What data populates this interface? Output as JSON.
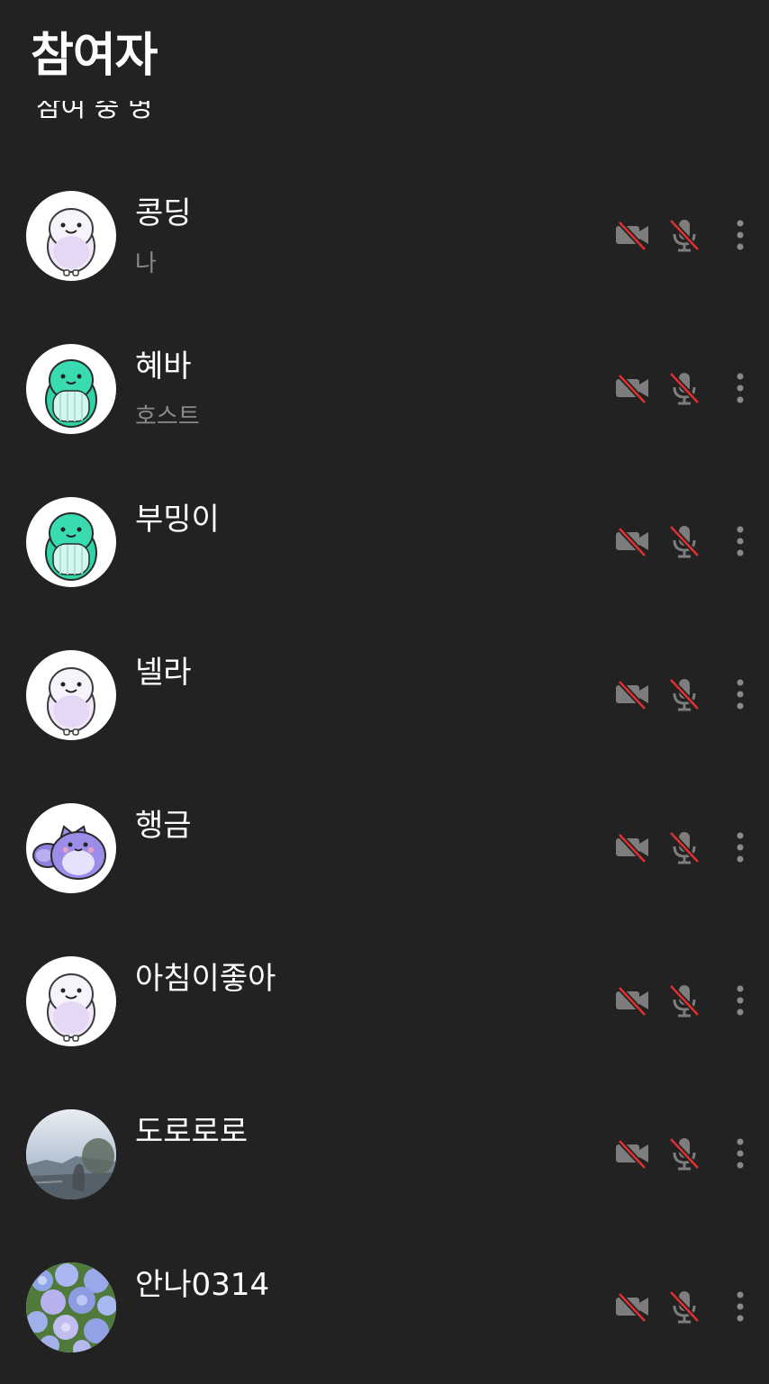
{
  "header": {
    "title": "참여자",
    "cut_text": "참여 중 명"
  },
  "participants": [
    {
      "name": "콩딩",
      "sub": "나",
      "avatar": "white-ghost-avatar"
    },
    {
      "name": "혜바",
      "sub": "호스트",
      "avatar": "teal-ghost-avatar"
    },
    {
      "name": "부밍이",
      "sub": "",
      "avatar": "teal-ghost-avatar"
    },
    {
      "name": "넬라",
      "sub": "",
      "avatar": "white-ghost-avatar"
    },
    {
      "name": "행금",
      "sub": "",
      "avatar": "purple-cat-avatar"
    },
    {
      "name": "아침이좋아",
      "sub": "",
      "avatar": "white-ghost-avatar"
    },
    {
      "name": "도로로로",
      "sub": "",
      "avatar": "photo-sky-avatar"
    },
    {
      "name": "안나0314",
      "sub": "",
      "avatar": "photo-hydrangea-avatar"
    }
  ],
  "icons": {
    "camera_off": "camera-off-icon",
    "mic_off": "mic-off-icon",
    "more": "more-vertical-icon"
  },
  "colors": {
    "background": "#222222",
    "icon_gray": "#7d7d7d",
    "strike_red": "#e0302f",
    "subtext": "#8a8a8a"
  }
}
